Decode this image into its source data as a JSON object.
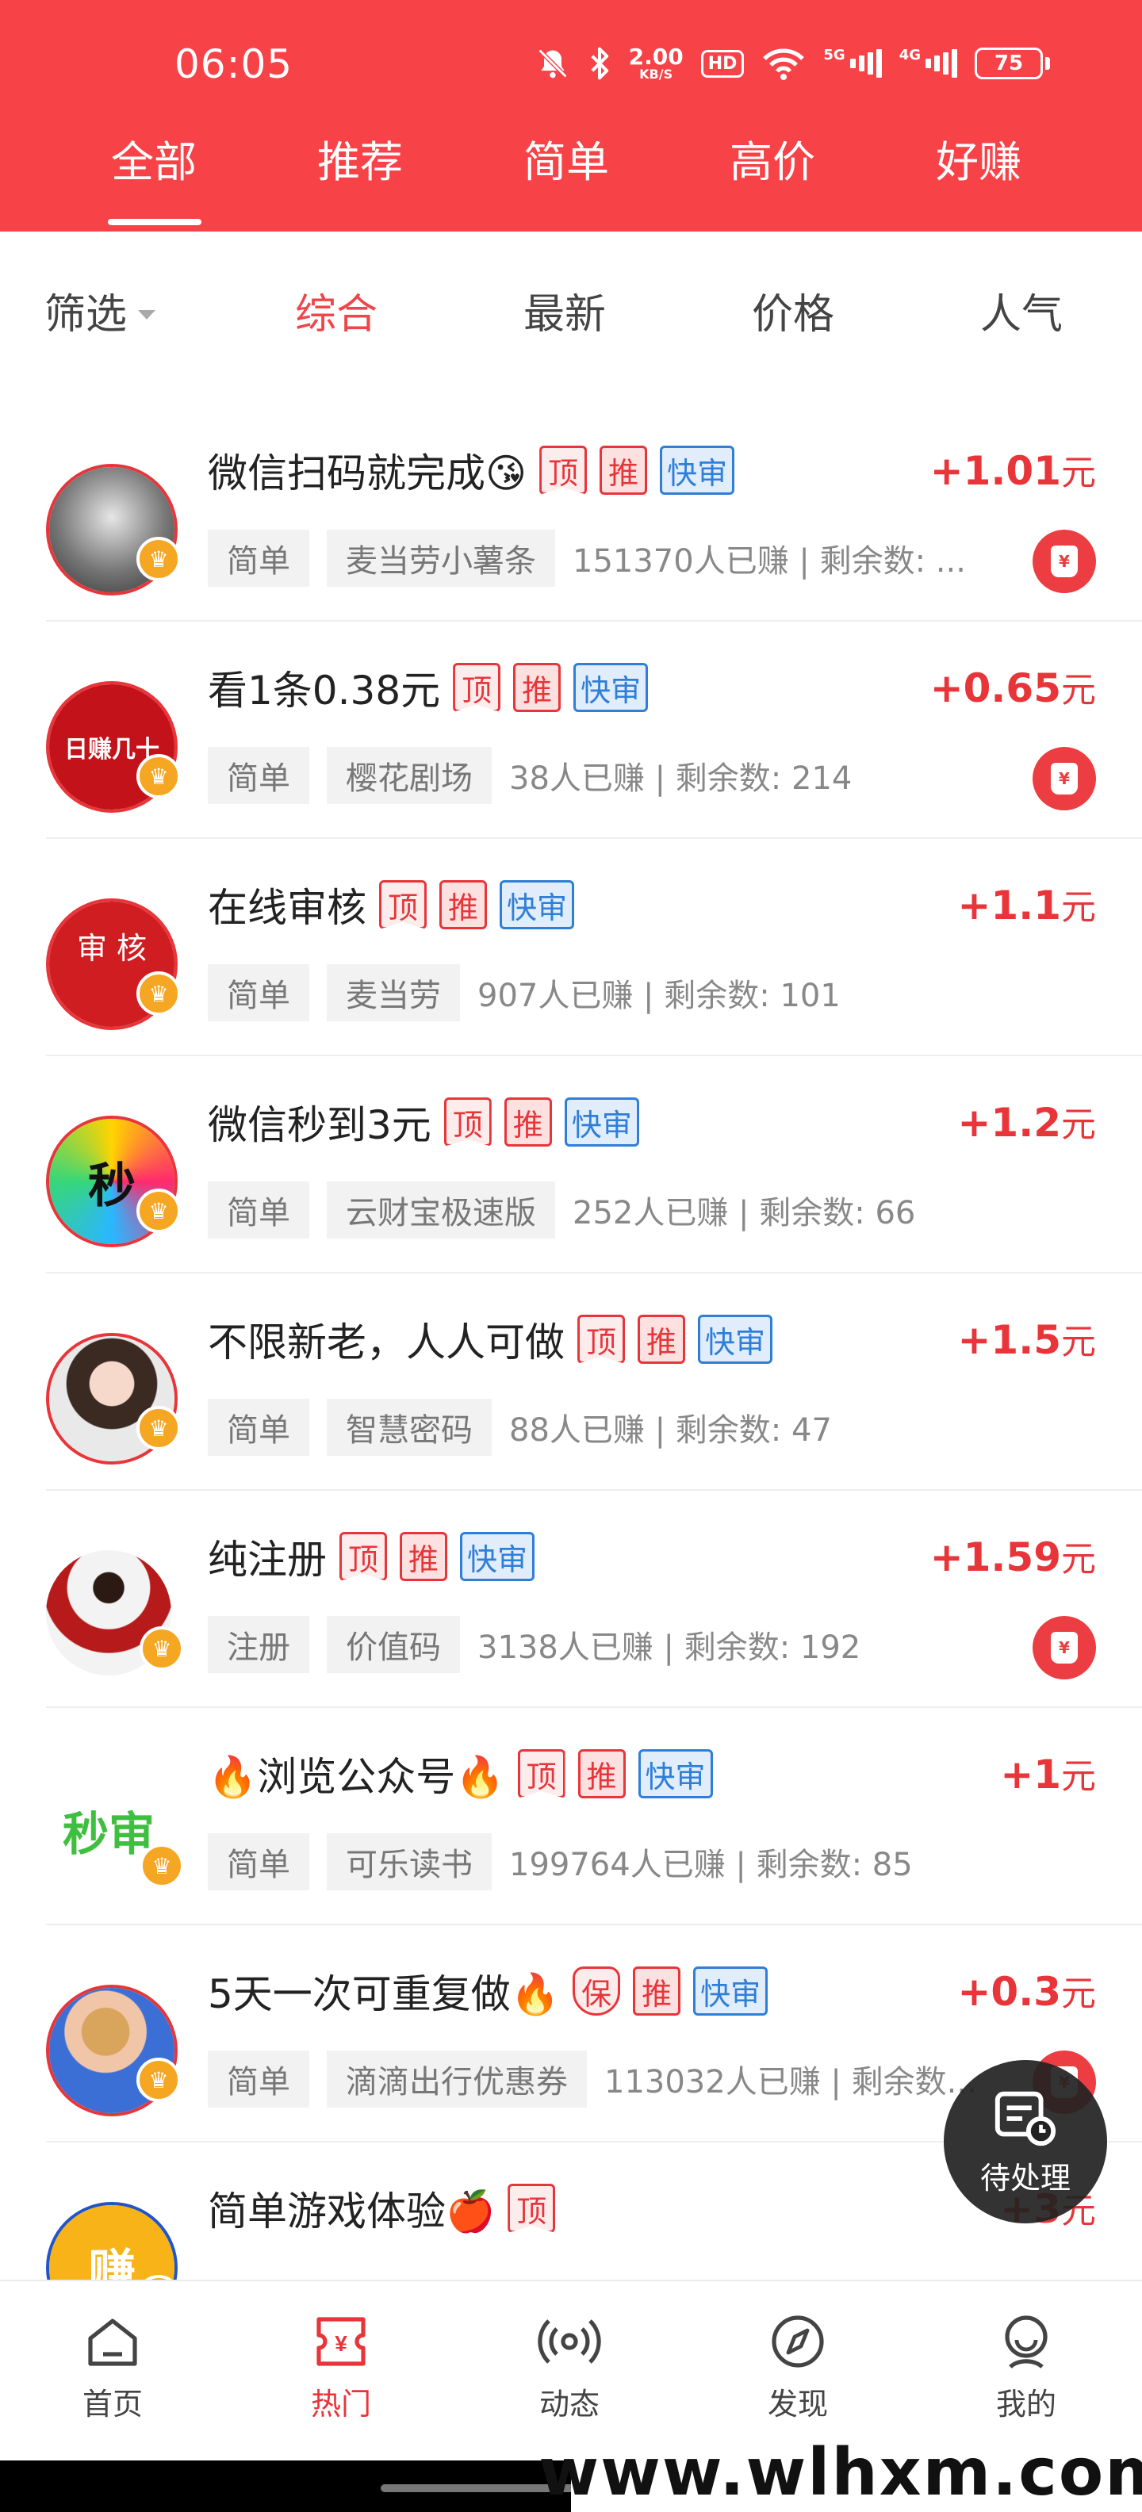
{
  "status_bar": {
    "time": "06:05",
    "net_speed": "2.00",
    "net_unit": "KB/S",
    "hd": "HD",
    "sig1": "5G",
    "sig2": "4G",
    "battery": "75"
  },
  "top_tabs": [
    {
      "label": "全部",
      "active": true
    },
    {
      "label": "推荐",
      "active": false
    },
    {
      "label": "简单",
      "active": false
    },
    {
      "label": "高价",
      "active": false
    },
    {
      "label": "好赚",
      "active": false
    }
  ],
  "filter": {
    "filter_label": "筛选",
    "sorts": [
      "综合",
      "最新",
      "价格",
      "人气"
    ],
    "active": "综合"
  },
  "badges": {
    "top": "顶",
    "recommend": "推",
    "fast": "快审",
    "guarantee": "保"
  },
  "reward_unit": "元",
  "tasks": [
    {
      "title": "微信扫码就完成😘",
      "reward": "+1.01",
      "category": "简单",
      "merchant": "麦当劳小薯条",
      "stats": "151370人已赚 | 剩余数: ...",
      "avatar_text": ""
    },
    {
      "title": "看1条0.38元",
      "reward": "+0.65",
      "category": "简单",
      "merchant": "樱花剧场",
      "stats": "38人已赚 | 剩余数: 214",
      "avatar_text": "日赚几十"
    },
    {
      "title": "在线审核",
      "reward": "+1.1",
      "category": "简单",
      "merchant": "麦当劳",
      "stats": "907人已赚 | 剩余数: 101",
      "avatar_text": "审 核"
    },
    {
      "title": "微信秒到3元",
      "reward": "+1.2",
      "category": "简单",
      "merchant": "云财宝极速版",
      "stats": "252人已赚 | 剩余数: 66",
      "avatar_text": "秒"
    },
    {
      "title": "不限新老，人人可做",
      "reward": "+1.5",
      "category": "简单",
      "merchant": "智慧密码",
      "stats": "88人已赚 | 剩余数: 47",
      "avatar_text": ""
    },
    {
      "title": "纯注册",
      "reward": "+1.59",
      "category": "注册",
      "merchant": "价值码",
      "stats": "3138人已赚 | 剩余数: 192",
      "avatar_text": ""
    },
    {
      "title": "🔥浏览公众号🔥",
      "reward": "+1",
      "category": "简单",
      "merchant": "可乐读书",
      "stats": "199764人已赚 | 剩余数: 85",
      "avatar_text": "秒审"
    },
    {
      "title": "5天一次可重复做🔥",
      "reward": "+0.3",
      "category": "简单",
      "merchant": "滴滴出行优惠券",
      "stats": "113032人已赚 | 剩余数...",
      "avatar_text": ""
    },
    {
      "title": "简单游戏体验🍎",
      "reward": "+3",
      "category": "",
      "merchant": "",
      "stats": "",
      "avatar_text": ""
    }
  ],
  "fab": {
    "label": "待处理"
  },
  "bottom_nav": [
    {
      "label": "首页",
      "icon": "home-icon",
      "active": false
    },
    {
      "label": "热门",
      "icon": "hot-icon",
      "active": true
    },
    {
      "label": "动态",
      "icon": "broadcast-icon",
      "active": false
    },
    {
      "label": "发现",
      "icon": "compass-icon",
      "active": false
    },
    {
      "label": "我的",
      "icon": "profile-icon",
      "active": false
    }
  ],
  "watermark": "www.wlhxm.com",
  "colors": {
    "brand_red": "#f74348",
    "accent_red": "#e8353a",
    "fast_blue": "#2f7fd8"
  }
}
